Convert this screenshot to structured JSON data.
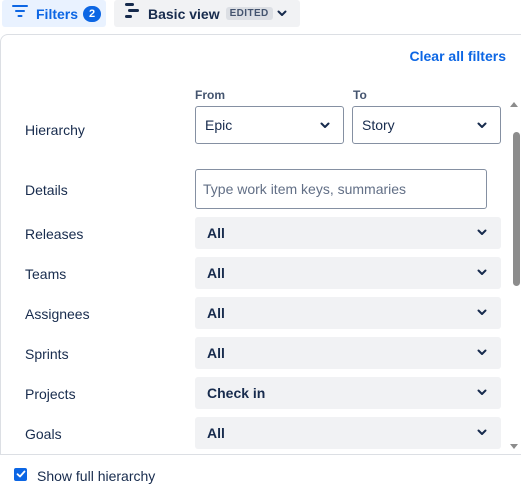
{
  "toolbar": {
    "filters_label": "Filters",
    "filters_count": "2",
    "view_label": "Basic view",
    "view_badge": "EDITED"
  },
  "panel": {
    "clear_all_label": "Clear all filters",
    "hierarchy": {
      "label": "Hierarchy",
      "from_label": "From",
      "from_value": "Epic",
      "to_label": "To",
      "to_value": "Story"
    },
    "details": {
      "label": "Details",
      "placeholder": "Type work item keys, summaries",
      "value": ""
    },
    "filters": [
      {
        "label": "Releases",
        "value": "All"
      },
      {
        "label": "Teams",
        "value": "All"
      },
      {
        "label": "Assignees",
        "value": "All"
      },
      {
        "label": "Sprints",
        "value": "All"
      },
      {
        "label": "Projects",
        "value": "Check in"
      },
      {
        "label": "Goals",
        "value": "All"
      }
    ]
  },
  "footer": {
    "show_full_hierarchy_label": "Show full hierarchy",
    "show_full_hierarchy_checked": true
  },
  "colors": {
    "accent": "#0c66e4",
    "accent_bg": "#e9f2ff",
    "neutral_bg": "#f1f2f4",
    "text": "#172b4d",
    "border": "#8590a2"
  },
  "icons": {
    "filters": "filter-lines-icon",
    "view": "view-list-icon",
    "dropdown": "chevron-down-icon",
    "checkbox": "checkmark-icon"
  }
}
